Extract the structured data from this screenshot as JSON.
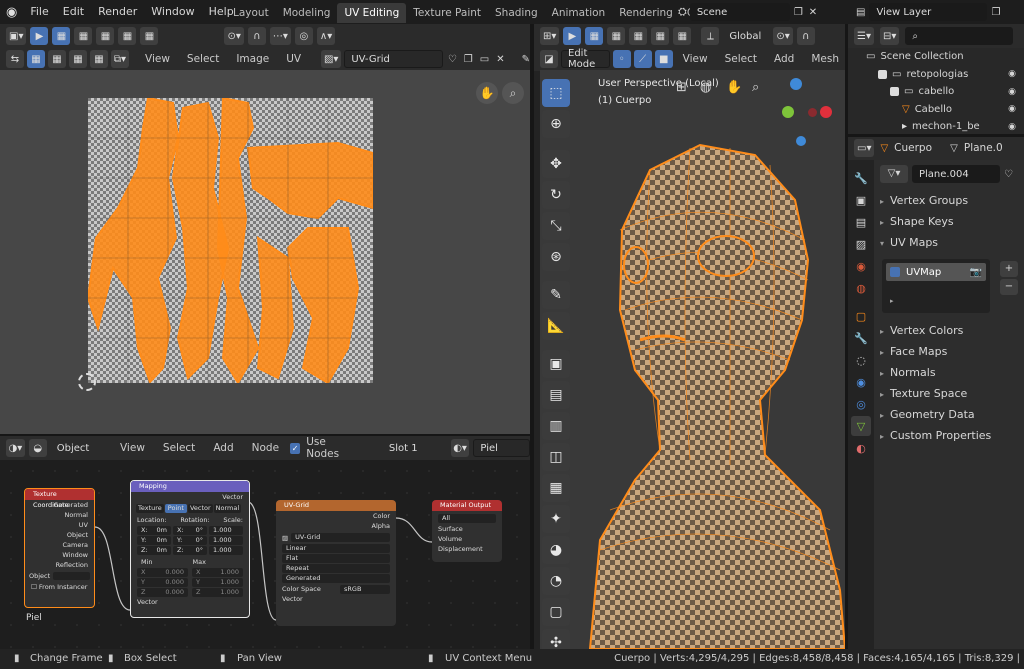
{
  "menubar": {
    "items": [
      "File",
      "Edit",
      "Render",
      "Window",
      "Help"
    ],
    "tabs": [
      "Layout",
      "Modeling",
      "UV Editing",
      "Texture Paint",
      "Shading",
      "Animation",
      "Rendering",
      "Con"
    ],
    "active_tab": 2,
    "scene": "Scene",
    "view_layer": "View Layer"
  },
  "uv_editor": {
    "menus": [
      "View",
      "Select",
      "Image",
      "UV"
    ],
    "image_name": "UV-Grid"
  },
  "node_editor": {
    "type": "Object",
    "menus": [
      "View",
      "Select",
      "Add",
      "Node"
    ],
    "use_nodes_label": "Use Nodes",
    "slot": "Slot 1",
    "material": "Piel",
    "material_label": "Piel",
    "nodes": {
      "texcoord": {
        "title": "Texture Coordinate",
        "outputs": [
          "Generated",
          "Normal",
          "UV",
          "Object",
          "Camera",
          "Window",
          "Reflection"
        ],
        "object_label": "Object",
        "from_instancer": "From Instancer"
      },
      "mapping": {
        "title": "Mapping",
        "vector_out": "Vector",
        "types": [
          "Texture",
          "Point",
          "Vector",
          "Normal"
        ],
        "active_type": 1,
        "location_label": "Location:",
        "rotation_label": "Rotation:",
        "scale_label": "Scale:",
        "rows": [
          {
            "axis": "X:",
            "loc": "0m",
            "rot": "0°",
            "scale": "1.000"
          },
          {
            "axis": "Y:",
            "loc": "0m",
            "rot": "0°",
            "scale": "1.000"
          },
          {
            "axis": "Z:",
            "loc": "0m",
            "rot": "0°",
            "scale": "1.000"
          }
        ],
        "min_label": "Min",
        "max_label": "Max",
        "minmax": [
          {
            "axis": "X",
            "min": "0.000",
            "max": "1.000"
          },
          {
            "axis": "Y",
            "min": "0.000",
            "max": "1.000"
          },
          {
            "axis": "Z",
            "min": "0.000",
            "max": "1.000"
          }
        ],
        "vector_in": "Vector"
      },
      "uvgrid": {
        "title": "UV-Grid",
        "outputs": [
          "Color",
          "Alpha"
        ],
        "image": "UV-Grid",
        "options": [
          "Linear",
          "Flat",
          "Repeat",
          "Generated"
        ],
        "color_space_label": "Color Space",
        "color_space": "sRGB",
        "vector_in": "Vector"
      },
      "output": {
        "title": "Material Output",
        "target": "All",
        "inputs": [
          "Surface",
          "Volume",
          "Displacement"
        ]
      }
    }
  },
  "viewport": {
    "mode": "Edit Mode",
    "orientation": "Global",
    "menus": [
      "View",
      "Select",
      "Add",
      "Mesh"
    ],
    "perspective": "User Perspective (Local)",
    "object": "(1) Cuerpo",
    "gizmo_axes": [
      "X",
      "Y",
      "Z"
    ]
  },
  "outliner": {
    "rows": [
      {
        "label": "Scene Collection",
        "indent": 0
      },
      {
        "label": "retopologias",
        "indent": 1
      },
      {
        "label": "cabello",
        "indent": 2
      },
      {
        "label": "Cabello",
        "indent": 3
      },
      {
        "label": "mechon-1_be",
        "indent": 3
      }
    ]
  },
  "properties": {
    "object": "Cuerpo",
    "mesh": "Plane.0",
    "data_name": "Plane.004",
    "panels_top": [
      "Vertex Groups",
      "Shape Keys",
      "UV Maps"
    ],
    "uv_map": "UVMap",
    "panels_bottom": [
      "Vertex Colors",
      "Face Maps",
      "Normals",
      "Texture Space",
      "Geometry Data",
      "Custom Properties"
    ]
  },
  "status": {
    "change_frame": "Change Frame",
    "box_select": "Box Select",
    "pan_view": "Pan View",
    "context_menu": "UV Context Menu",
    "stats": "Cuerpo | Verts:4,295/4,295 | Edges:8,458/8,458 | Faces:4,165/4,165 | Tris:8,329 |"
  },
  "colors": {
    "accent": "#4772b3",
    "selection_orange": "#ff8c1a",
    "axis_x": "#e0303c",
    "axis_y": "#7ec43a",
    "axis_z": "#3f8ad8"
  }
}
